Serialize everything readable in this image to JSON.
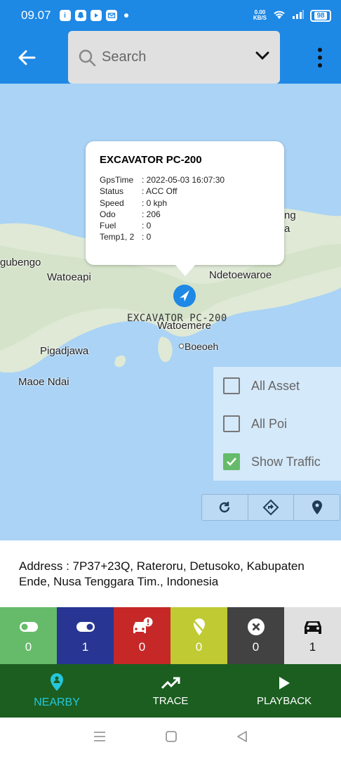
{
  "status_bar": {
    "time": "09.07",
    "app_icons": [
      "app-icon",
      "snapchat-icon",
      "youtube-icon",
      "mail-icon"
    ],
    "net_speed_value": "0.00",
    "net_speed_unit": "KB/S",
    "battery": "98"
  },
  "app_bar": {
    "back_icon": "arrow-left-icon",
    "search_placeholder": "Search",
    "dropdown_icon": "chevron-down-icon",
    "menu_icon": "more-vert-icon"
  },
  "map": {
    "places": [
      "Watoeapi",
      "gubengo",
      "Ndetoewaroe",
      "Watoemere",
      "Boeoeh",
      "Pigadjawa",
      "Maoe Ndai",
      "ng",
      "a"
    ],
    "vehicle_label": "EXCAVATOR PC-200",
    "popup": {
      "title": "EXCAVATOR PC-200",
      "rows": [
        {
          "key": "GpsTime",
          "value": ": 2022-05-03 16:07:30"
        },
        {
          "key": "Status",
          "value": ": ACC Off"
        },
        {
          "key": "Speed",
          "value": ": 0 kph"
        },
        {
          "key": "Odo",
          "value": ": 206"
        },
        {
          "key": "Fuel",
          "value": ": 0"
        },
        {
          "key": "Temp1, 2",
          "value": ": 0"
        }
      ]
    },
    "filters": [
      {
        "label": "All Asset",
        "checked": false
      },
      {
        "label": "All Poi",
        "checked": false
      },
      {
        "label": "Show Traffic",
        "checked": true
      }
    ],
    "tools": [
      "refresh-icon",
      "directions-icon",
      "location-pin-icon"
    ]
  },
  "address": {
    "text": "Address : 7P37+23Q, Rateroru, Detusoko, Kabupaten Ende, Nusa Tenggara Tim., Indonesia"
  },
  "status_counts": [
    {
      "icon": "toggle-on-icon",
      "count": "0",
      "color": "#66bb6a"
    },
    {
      "icon": "toggle-off-icon",
      "count": "1",
      "color": "#283593"
    },
    {
      "icon": "car-alert-icon",
      "count": "0",
      "color": "#c62828"
    },
    {
      "icon": "location-off-icon",
      "count": "0",
      "color": "#c0ca33"
    },
    {
      "icon": "close-circle-icon",
      "count": "0",
      "color": "#424242"
    },
    {
      "icon": "car-icon",
      "count": "1",
      "color": "#e0e0e0"
    }
  ],
  "bottom_nav": [
    {
      "label": "NEARBY",
      "icon": "nearby-icon",
      "active": true
    },
    {
      "label": "TRACE",
      "icon": "trending-up-icon",
      "active": false
    },
    {
      "label": "PLAYBACK",
      "icon": "play-icon",
      "active": false
    }
  ],
  "colors": {
    "primary": "#1e88e5",
    "nav_bg": "#1b5e20",
    "active_nav": "#26c6da",
    "map_water": "#aad3f5",
    "map_land": "#dfe9d6"
  }
}
